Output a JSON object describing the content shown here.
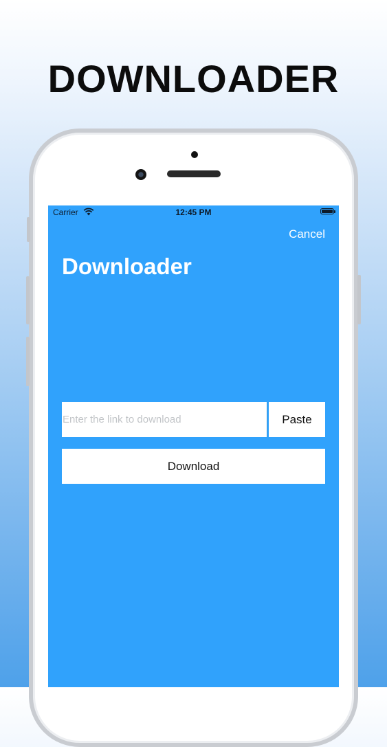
{
  "promo": {
    "title": "DOWNLOADER"
  },
  "status_bar": {
    "carrier": "Carrier",
    "time": "12:45 PM",
    "wifi_icon": "wifi-icon",
    "battery_icon": "battery-icon"
  },
  "nav": {
    "cancel_label": "Cancel",
    "title": "Downloader"
  },
  "form": {
    "link_placeholder": "Enter the link to download",
    "link_value": "",
    "paste_label": "Paste",
    "download_label": "Download"
  },
  "colors": {
    "screen_background": "#30a2fc",
    "button_background": "#ffffff"
  }
}
